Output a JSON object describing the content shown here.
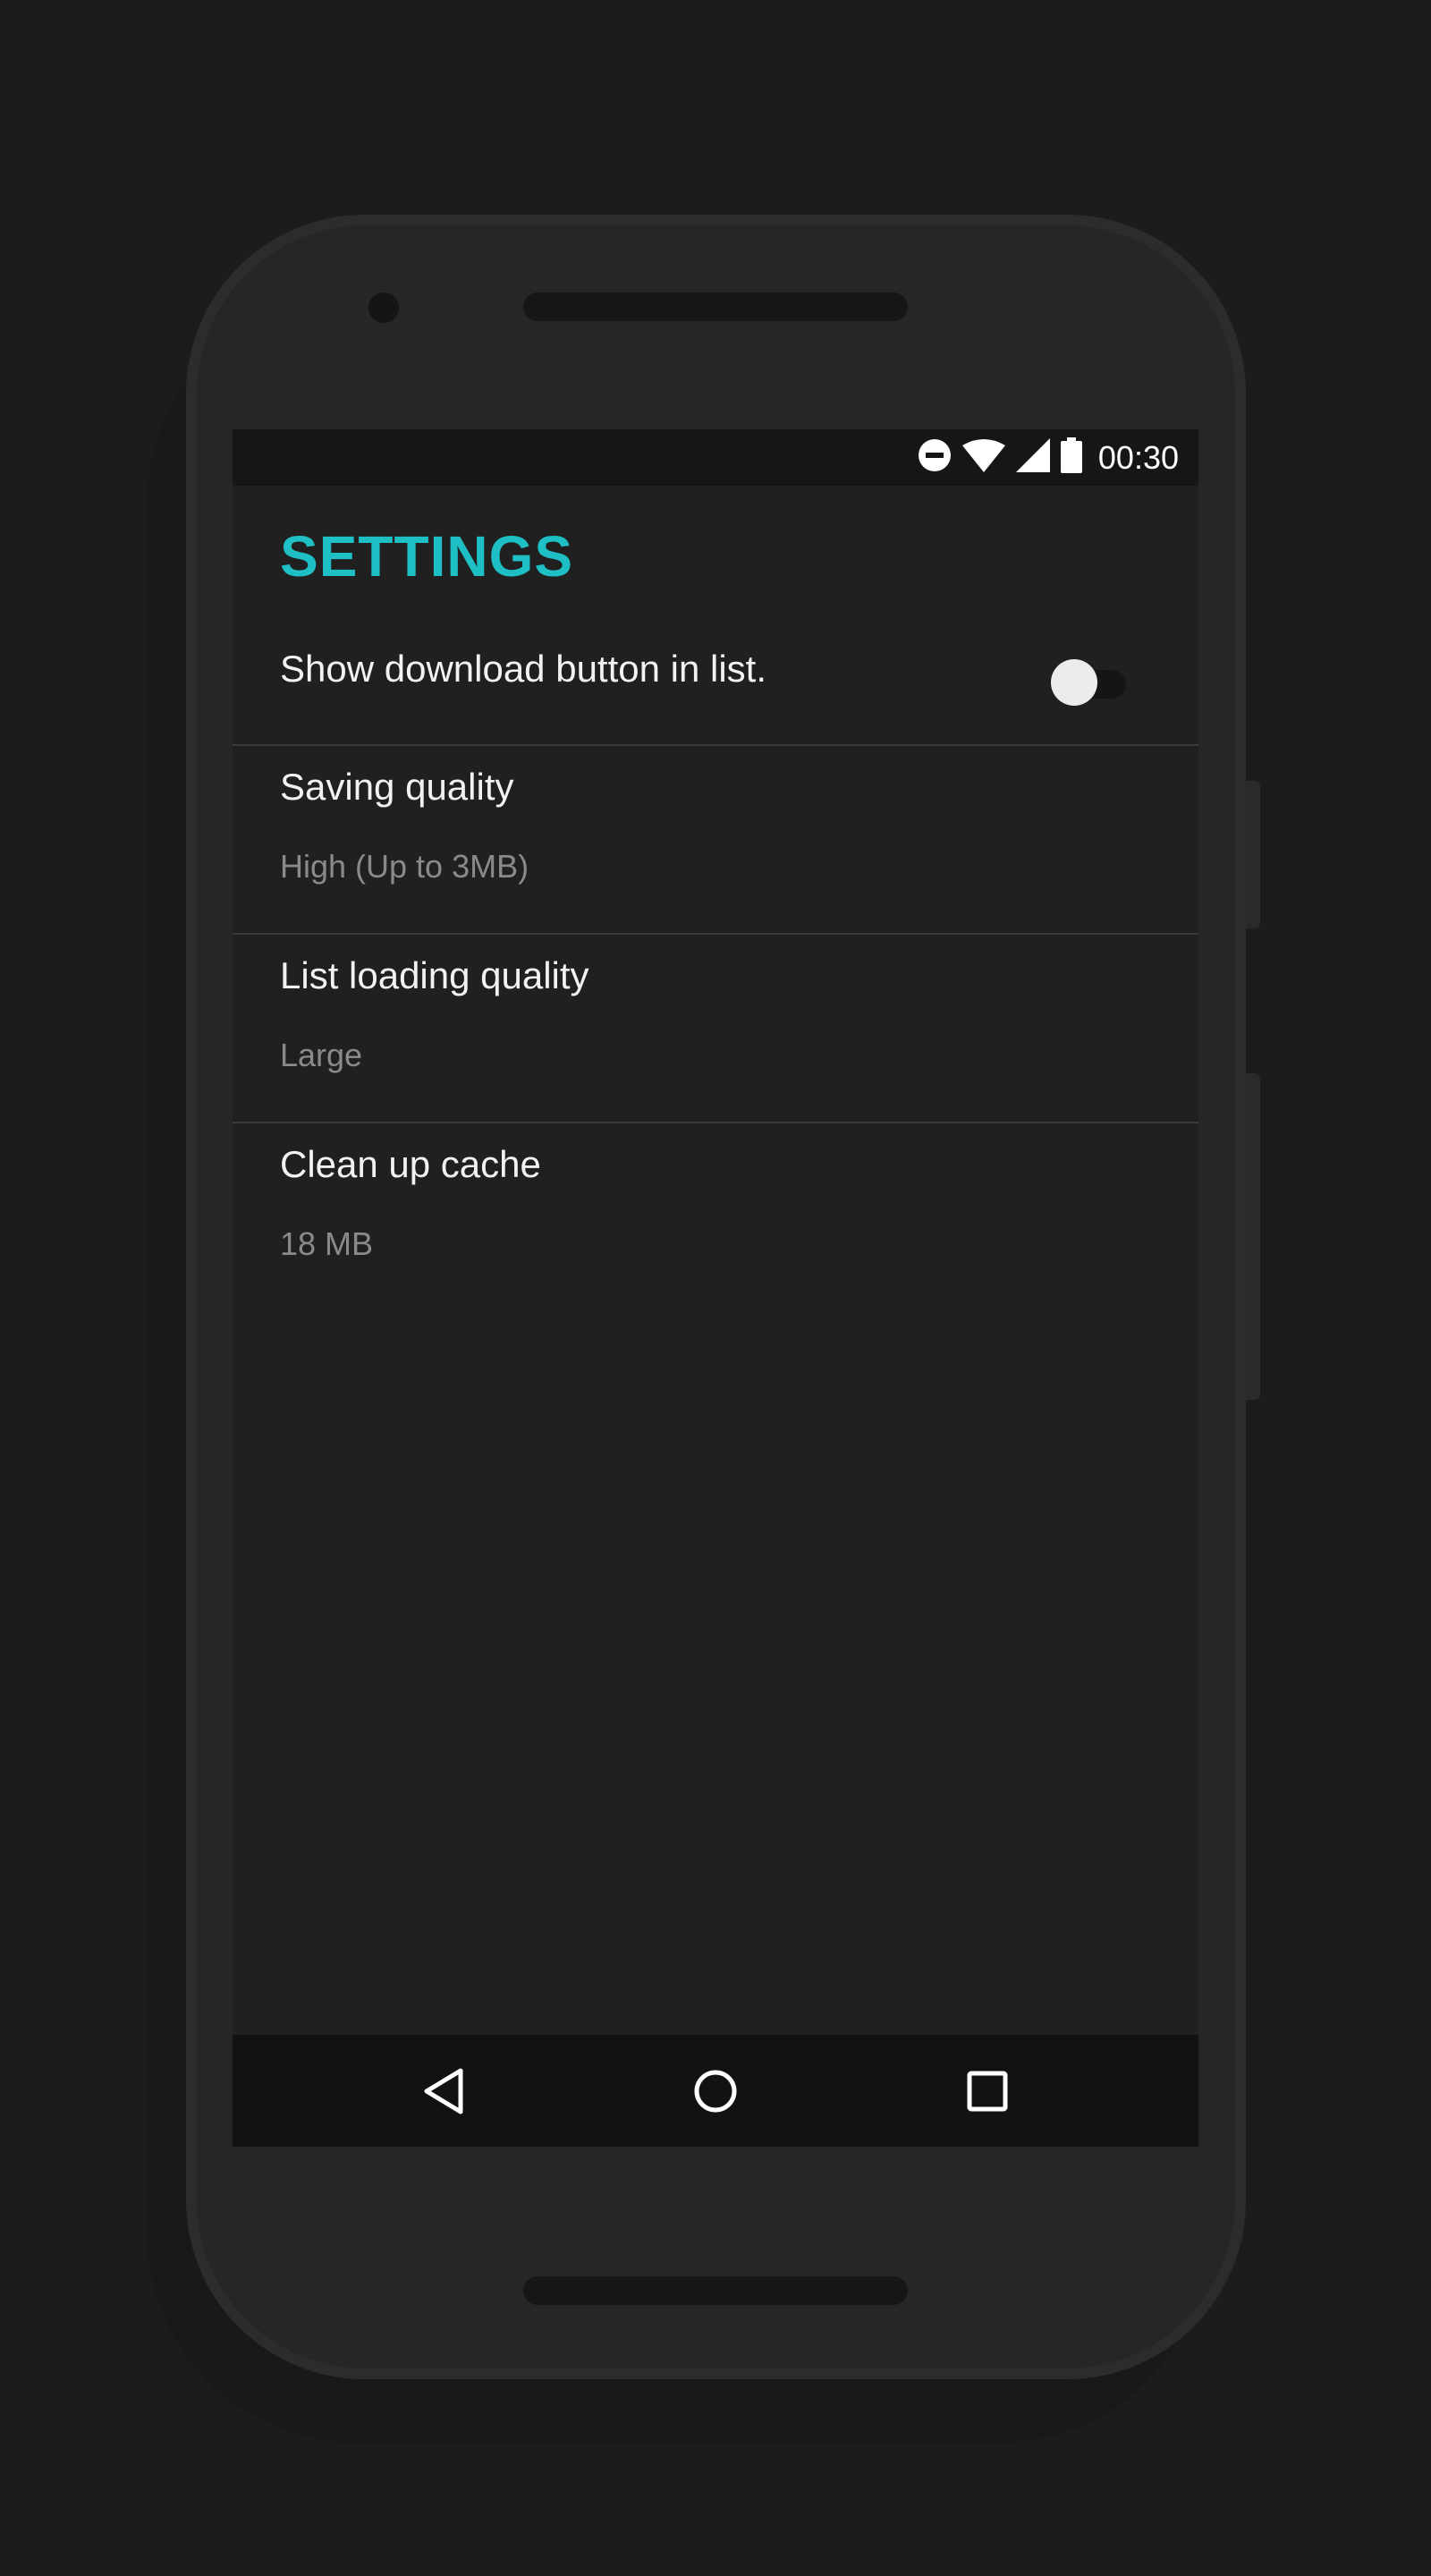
{
  "status_bar": {
    "time": "00:30",
    "icons": [
      "do-not-disturb-icon",
      "wifi-icon",
      "cell-signal-icon",
      "battery-icon"
    ]
  },
  "app": {
    "title": "SETTINGS",
    "accent_color": "#1ebfc5"
  },
  "preferences": {
    "download_button": {
      "label": "Show download button in list.",
      "enabled": false
    },
    "saving_quality": {
      "label": "Saving quality",
      "summary": "High (Up to 3MB)"
    },
    "list_loading_quality": {
      "label": "List loading quality",
      "summary": "Large"
    },
    "clean_cache": {
      "label": "Clean up cache",
      "summary": "18 MB"
    }
  },
  "nav_bar": {
    "buttons": [
      "back-icon",
      "home-icon",
      "recents-icon"
    ]
  }
}
